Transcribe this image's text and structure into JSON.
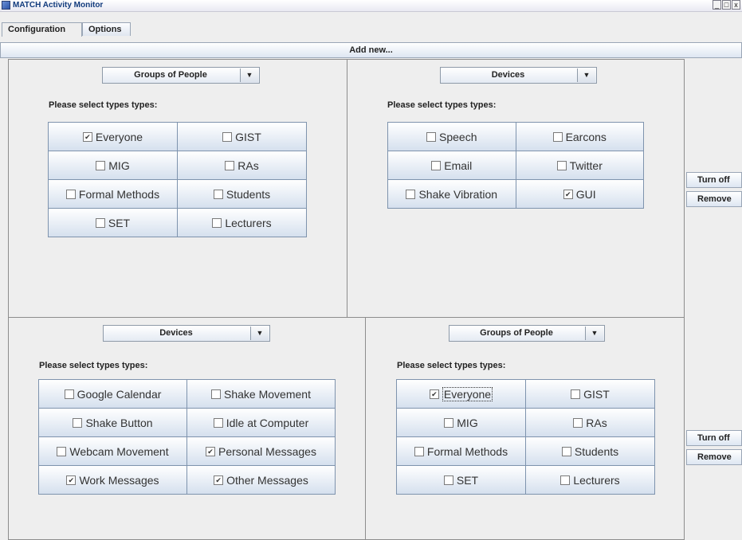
{
  "window": {
    "title": "MATCH Activity Monitor",
    "min": "_",
    "max": "□",
    "close": "x"
  },
  "tabs": [
    {
      "label": "Configuration"
    },
    {
      "label": "Options"
    }
  ],
  "add_new_label": "Add new...",
  "prompt_text": "Please select types types:",
  "panels": [
    {
      "combo": "Groups of People",
      "items": [
        {
          "label": "Everyone",
          "checked": true
        },
        {
          "label": "GIST",
          "checked": false
        },
        {
          "label": "MIG",
          "checked": false
        },
        {
          "label": "RAs",
          "checked": false
        },
        {
          "label": "Formal Methods",
          "checked": false
        },
        {
          "label": "Students",
          "checked": false
        },
        {
          "label": "SET",
          "checked": false
        },
        {
          "label": "Lecturers",
          "checked": false
        }
      ]
    },
    {
      "combo": "Devices",
      "items": [
        {
          "label": "Speech",
          "checked": false
        },
        {
          "label": "Earcons",
          "checked": false
        },
        {
          "label": "Email",
          "checked": false
        },
        {
          "label": "Twitter",
          "checked": false
        },
        {
          "label": "Shake Vibration",
          "checked": false
        },
        {
          "label": "GUI",
          "checked": true
        }
      ]
    },
    {
      "combo": "Devices",
      "items": [
        {
          "label": "Google Calendar",
          "checked": false
        },
        {
          "label": "Shake Movement",
          "checked": false
        },
        {
          "label": "Shake Button",
          "checked": false
        },
        {
          "label": "Idle at Computer",
          "checked": false
        },
        {
          "label": "Webcam Movement",
          "checked": false
        },
        {
          "label": "Personal Messages",
          "checked": true
        },
        {
          "label": "Work Messages",
          "checked": true
        },
        {
          "label": "Other Messages",
          "checked": true
        }
      ]
    },
    {
      "combo": "Groups of People",
      "items": [
        {
          "label": "Everyone",
          "checked": true
        },
        {
          "label": "GIST",
          "checked": false
        },
        {
          "label": "MIG",
          "checked": false
        },
        {
          "label": "RAs",
          "checked": false
        },
        {
          "label": "Formal Methods",
          "checked": false
        },
        {
          "label": "Students",
          "checked": false
        },
        {
          "label": "SET",
          "checked": false
        },
        {
          "label": "Lecturers",
          "checked": false
        }
      ]
    }
  ],
  "row_buttons": [
    {
      "turn_off": "Turn off",
      "remove": "Remove"
    },
    {
      "turn_off": "Turn off",
      "remove": "Remove"
    }
  ],
  "colors": {
    "title_text": "#103a7c",
    "button_gradient_bottom": "#d5e0ee"
  }
}
